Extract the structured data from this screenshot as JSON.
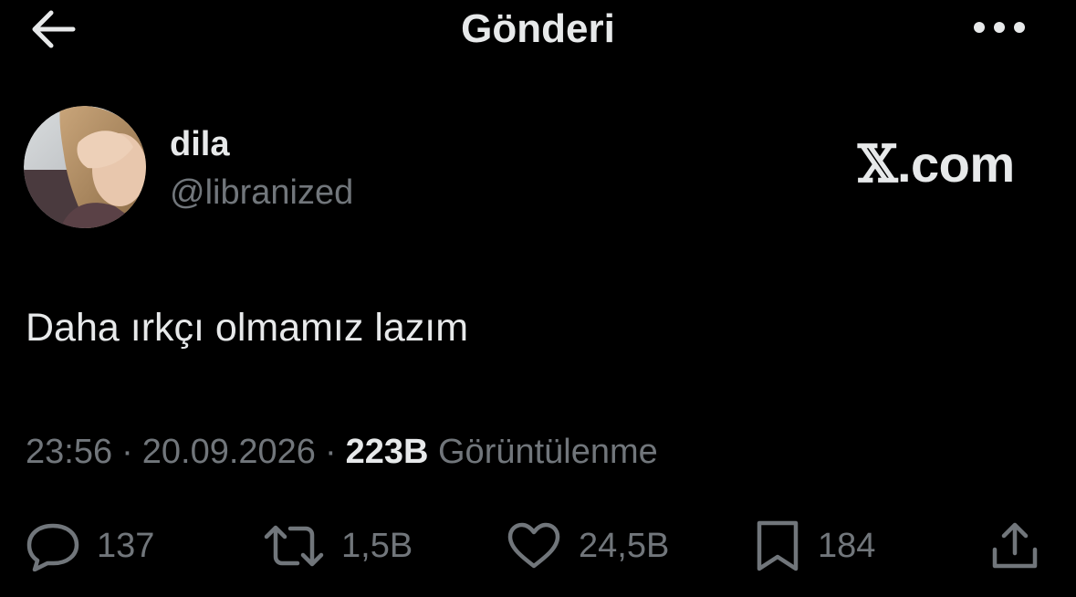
{
  "header": {
    "title": "Gönderi",
    "back_icon": "arrow-left-icon",
    "more_icon": "more-horizontal-icon"
  },
  "author": {
    "display_name": "dila",
    "handle": "@libranized",
    "avatar_icon": "profile-photo"
  },
  "watermark": {
    "brand_text": ".com",
    "brand_letter": "𝕏"
  },
  "tweet": {
    "text": "Daha ırkçı olmamız lazım"
  },
  "meta": {
    "time": "23:56",
    "separator": "·",
    "date": "20.09.2026",
    "views_count": "223B",
    "views_label": "Görüntülenme"
  },
  "actions": {
    "reply": {
      "icon": "reply-icon",
      "count": "137"
    },
    "repost": {
      "icon": "repost-icon",
      "count": "1,5B"
    },
    "like": {
      "icon": "heart-icon",
      "count": "24,5B"
    },
    "bookmark": {
      "icon": "bookmark-icon",
      "count": "184"
    },
    "share": {
      "icon": "share-icon"
    }
  },
  "colors": {
    "background": "#000000",
    "primary_text": "#e7e9ea",
    "secondary_text": "#71767b"
  }
}
